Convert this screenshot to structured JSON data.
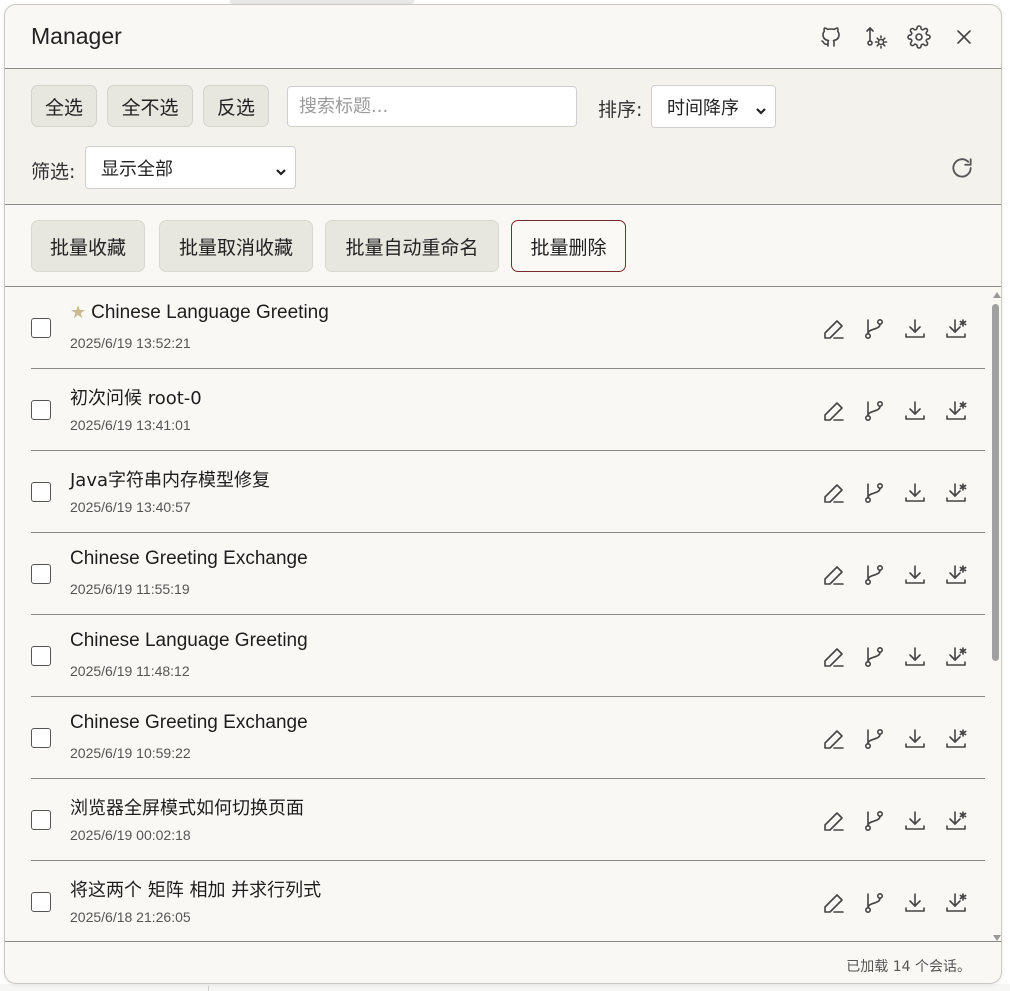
{
  "header": {
    "title": "Manager",
    "icons": [
      "github-icon",
      "git-compare-icon",
      "gear-icon",
      "close-icon"
    ]
  },
  "toolbar": {
    "select_all": "全选",
    "select_none": "全不选",
    "invert": "反选",
    "search_placeholder": "搜索标题...",
    "search_value": "",
    "sort_label": "排序:",
    "sort_value": "时间降序",
    "filter_label": "筛选:",
    "filter_value": "显示全部"
  },
  "batch": {
    "favorite": "批量收藏",
    "unfavorite": "批量取消收藏",
    "auto_rename": "批量自动重命名",
    "delete": "批量删除"
  },
  "sessions": [
    {
      "title": "Chinese Language Greeting",
      "date": "2025/6/19 13:52:21",
      "starred": true
    },
    {
      "title": "初次问候 root-0",
      "date": "2025/6/19 13:41:01",
      "starred": false
    },
    {
      "title": "Java字符串内存模型修复",
      "date": "2025/6/19 13:40:57",
      "starred": false
    },
    {
      "title": "Chinese Greeting Exchange",
      "date": "2025/6/19 11:55:19",
      "starred": false
    },
    {
      "title": "Chinese Language Greeting",
      "date": "2025/6/19 11:48:12",
      "starred": false
    },
    {
      "title": "Chinese Greeting Exchange",
      "date": "2025/6/19 10:59:22",
      "starred": false
    },
    {
      "title": "浏览器全屏模式如何切换页面",
      "date": "2025/6/19 00:02:18",
      "starred": false
    },
    {
      "title": "将这两个 矩阵 相加 并求行列式",
      "date": "2025/6/18 21:26:05",
      "starred": false
    }
  ],
  "row_actions": [
    "edit-icon",
    "branch-icon",
    "download-icon",
    "download-special-icon"
  ],
  "footer": {
    "status": "已加载 14 个会话。"
  },
  "colors": {
    "panel_bg": "#f9f8f4",
    "toolbar_bg": "#f3f2ed",
    "button_bg": "#e7e6df",
    "danger_border": "#7a2a2a",
    "star": "#c9b98e"
  }
}
